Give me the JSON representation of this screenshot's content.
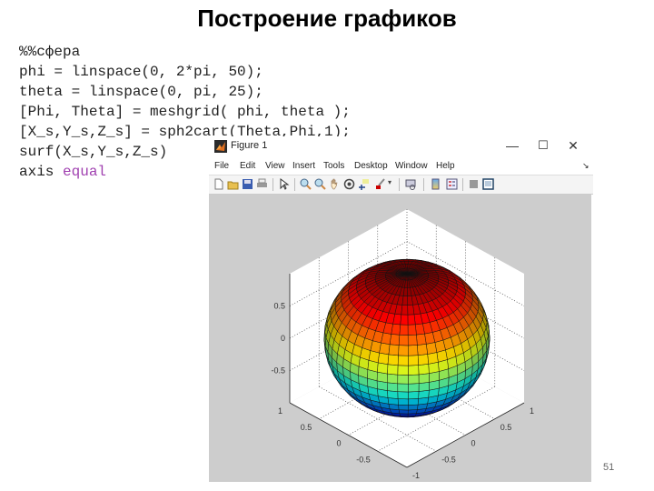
{
  "slide": {
    "title": "Построение графиков",
    "page_number": "51"
  },
  "code": {
    "lines": [
      "%%сфера",
      "phi = linspace(0, 2*pi, 50);",
      "theta = linspace(0, pi, 25);",
      "[Phi, Theta] = meshgrid( phi, theta );",
      "[X_s,Y_s,Z_s] = sph2cart(Theta,Phi,1);",
      "surf(X_s,Y_s,Z_s)"
    ],
    "last_line_cmd": "axis ",
    "last_line_arg": "equal"
  },
  "window": {
    "title": "Figure 1",
    "controls": {
      "minimize": "—",
      "maximize": "☐",
      "close": "✕"
    },
    "menu": [
      "File",
      "Edit",
      "View",
      "Insert",
      "Tools",
      "Desktop",
      "Window",
      "Help"
    ],
    "toolbar_icons": [
      "new-figure-icon",
      "open-file-icon",
      "save-icon",
      "print-icon",
      "select-arrow-icon",
      "zoom-in-icon",
      "zoom-out-icon",
      "pan-hand-icon",
      "rotate-3d-icon",
      "data-cursor-icon",
      "brush-icon",
      "link-plot-icon",
      "colorbar-icon",
      "legend-icon",
      "hide-plot-tools-icon",
      "show-plot-tools-icon"
    ]
  },
  "chart_data": {
    "type": "surface",
    "description": "unit sphere surf plot, jet colormap by Z, axis equal",
    "z_ticks": [
      "0.5",
      "0",
      "-0.5"
    ],
    "x_ticks": [
      "1",
      "0.5",
      "0",
      "-0.5",
      "-1"
    ],
    "y_ticks": [
      "1",
      "0.5",
      "0",
      "-0.5"
    ],
    "xlim": [
      -1,
      1
    ],
    "ylim": [
      -1,
      1
    ],
    "zlim": [
      -1,
      1
    ],
    "phi_points": 50,
    "theta_points": 25,
    "radius": 1,
    "colormap": "jet",
    "grid": true
  }
}
